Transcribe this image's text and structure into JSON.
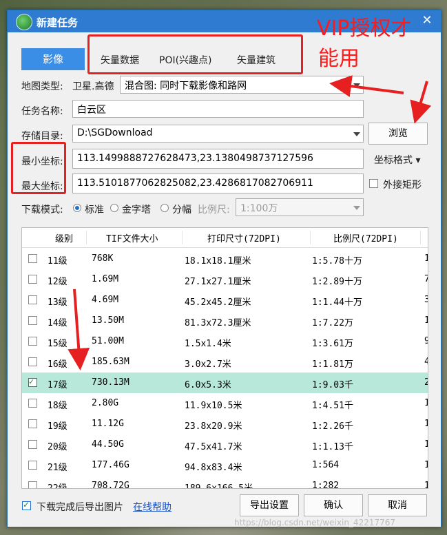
{
  "window": {
    "title": "新建任务",
    "close": "✕"
  },
  "tabs": [
    {
      "label": "影像",
      "active": true
    },
    {
      "label": "矢量数据"
    },
    {
      "label": "POI(兴趣点)"
    },
    {
      "label": "矢量建筑"
    }
  ],
  "annotation": {
    "vip_line1": "VIP授权才",
    "vip_line2": "能用"
  },
  "form": {
    "map_type_label": "地图类型:",
    "map_type_value": "卫星.高德",
    "map_type_select": "混合图: 同时下载影像和路网",
    "task_name_label": "任务名称:",
    "task_name_value": "白云区",
    "storage_label": "存储目录:",
    "storage_value": "D:\\SGDownload",
    "browse_button": "浏览",
    "min_coord_label": "最小坐标:",
    "min_coord_value": "113.1499888727628473,23.1380498737127596",
    "max_coord_label": "最大坐标:",
    "max_coord_value": "113.5101877062825082,23.4286817082706911",
    "coord_format_button": "坐标格式 ▾",
    "bbox_checkbox_label": "外接矩形",
    "download_mode_label": "下载模式:",
    "mode_standard": "标准",
    "mode_pyramid": "金字塔",
    "mode_tiled": "分幅",
    "scale_label": "比例尺:",
    "scale_value": "1:100万"
  },
  "table": {
    "headers": [
      "级别",
      "TIF文件大小",
      "打印尺寸(72DPI)",
      "比例尺(72DPI)"
    ],
    "rows": [
      {
        "checked": false,
        "level": "11级",
        "size": "768K",
        "print": "18.1x18.1厘米",
        "scale": "1:5.78十万",
        "extra": "1"
      },
      {
        "checked": false,
        "level": "12级",
        "size": "1.69M",
        "print": "27.1x27.1厘米",
        "scale": "1:2.89十万",
        "extra": "7"
      },
      {
        "checked": false,
        "level": "13级",
        "size": "4.69M",
        "print": "45.2x45.2厘米",
        "scale": "1:1.44十万",
        "extra": "3"
      },
      {
        "checked": false,
        "level": "14级",
        "size": "13.50M",
        "print": "81.3x72.3厘米",
        "scale": "1:7.22万",
        "extra": "1"
      },
      {
        "checked": false,
        "level": "15级",
        "size": "51.00M",
        "print": "1.5x1.4米",
        "scale": "1:3.61万",
        "extra": "9"
      },
      {
        "checked": false,
        "level": "16级",
        "size": "185.63M",
        "print": "3.0x2.7米",
        "scale": "1:1.81万",
        "extra": "4"
      },
      {
        "checked": true,
        "level": "17级",
        "size": "730.13M",
        "print": "6.0x5.3米",
        "scale": "1:9.03千",
        "extra": "2"
      },
      {
        "checked": false,
        "level": "18级",
        "size": "2.80G",
        "print": "11.9x10.5米",
        "scale": "1:4.51千",
        "extra": "1"
      },
      {
        "checked": false,
        "level": "19级",
        "size": "11.12G",
        "print": "23.8x20.9米",
        "scale": "1:2.26千",
        "extra": "1"
      },
      {
        "checked": false,
        "level": "20级",
        "size": "44.50G",
        "print": "47.5x41.7米",
        "scale": "1:1.13千",
        "extra": "1"
      },
      {
        "checked": false,
        "level": "21级",
        "size": "177.46G",
        "print": "94.8x83.4米",
        "scale": "1:564",
        "extra": "1"
      },
      {
        "checked": false,
        "level": "22级",
        "size": "708.72G",
        "print": "189.6x166.5米",
        "scale": "1:282",
        "extra": "1"
      }
    ]
  },
  "footer": {
    "export_checkbox_label": "下载完成后导出图片",
    "online_help": "在线帮助",
    "export_settings_button": "导出设置",
    "confirm_button": "确认",
    "cancel_button": "取消"
  },
  "watermark": "https://blog.csdn.net/weixin_42217767",
  "colors": {
    "titlebar": "#2e7bd1",
    "tab_active": "#3a8ee6",
    "selected_row": "#b7e8d9",
    "annotation": "#e62020"
  }
}
